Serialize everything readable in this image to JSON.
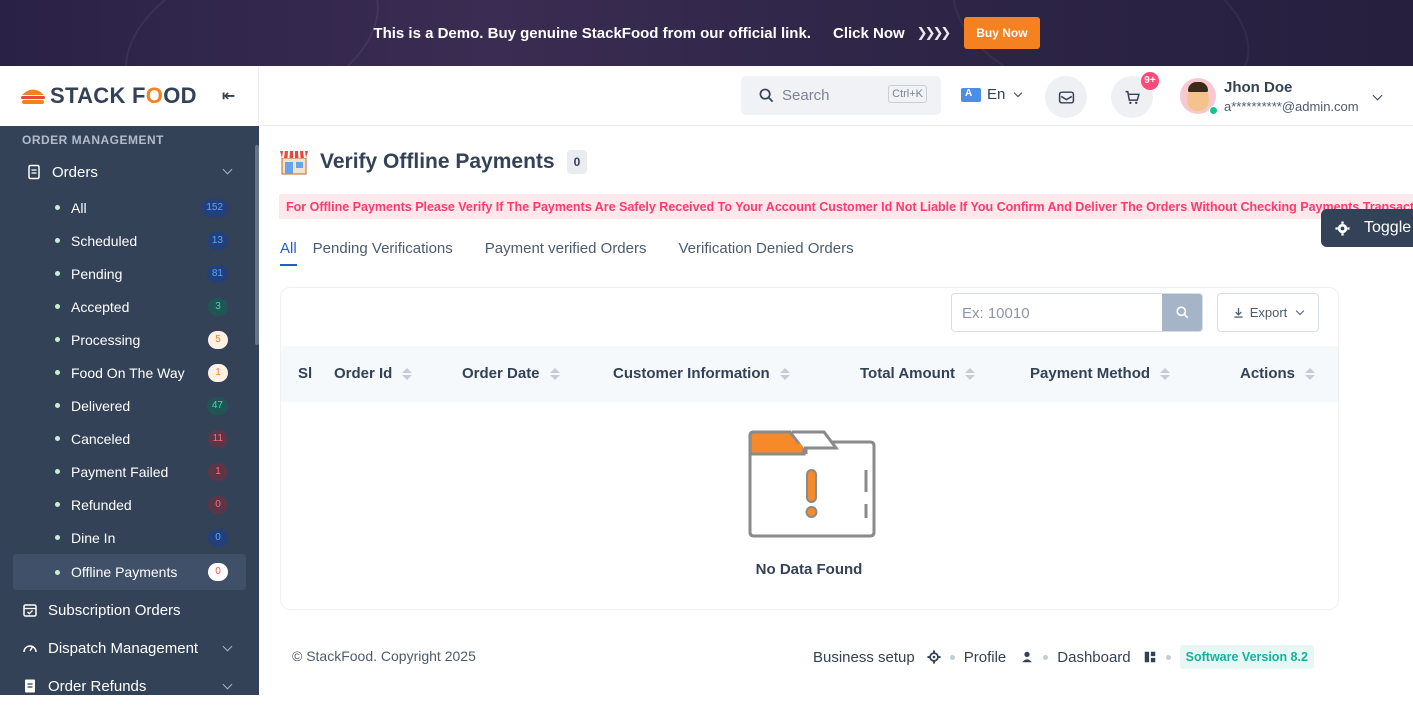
{
  "banner": {
    "text": "This is a Demo. Buy genuine StackFood from our official link.",
    "click_text": "Click Now",
    "buy_button": "Buy Now"
  },
  "brand": {
    "name_part1": "STACK F",
    "name_o": "O",
    "name_part2": "OD"
  },
  "sidebar": {
    "section_title": "ORDER MANAGEMENT",
    "orders_label": "Orders",
    "items": [
      {
        "label": "All",
        "count": "152",
        "color": "blue"
      },
      {
        "label": "Scheduled",
        "count": "13",
        "color": "blue"
      },
      {
        "label": "Pending",
        "count": "81",
        "color": "blue"
      },
      {
        "label": "Accepted",
        "count": "3",
        "color": "teal"
      },
      {
        "label": "Processing",
        "count": "5",
        "color": "orange"
      },
      {
        "label": "Food On The Way",
        "count": "1",
        "color": "orange"
      },
      {
        "label": "Delivered",
        "count": "47",
        "color": "teal"
      },
      {
        "label": "Canceled",
        "count": "11",
        "color": "red"
      },
      {
        "label": "Payment Failed",
        "count": "1",
        "color": "red"
      },
      {
        "label": "Refunded",
        "count": "0",
        "color": "red"
      },
      {
        "label": "Dine In",
        "count": "0",
        "color": "blue"
      },
      {
        "label": "Offline Payments",
        "count": "0",
        "color": "white"
      }
    ],
    "subscription_orders": "Subscription Orders",
    "dispatch_management": "Dispatch Management",
    "order_refunds": "Order Refunds"
  },
  "header": {
    "search_placeholder": "Search",
    "search_shortcut": "Ctrl+K",
    "language": "En",
    "cart_badge": "9+",
    "user_name": "Jhon Doe",
    "user_email": "a**********@admin.com"
  },
  "page": {
    "title": "Verify Offline Payments",
    "count": "0",
    "alert": "For Offline Payments Please Verify If The Payments Are Safely Received To Your Account Customer Id Not Liable If You Confirm And Deliver The Orders Without Checking Payments Transactions",
    "toggle": "Toggle",
    "tabs": [
      "All",
      "Pending Verifications",
      "Payment verified Orders",
      "Verification Denied Orders"
    ]
  },
  "table": {
    "search_placeholder": "Ex: 10010",
    "export_label": "Export",
    "columns": [
      "Sl",
      "Order Id",
      "Order Date",
      "Customer Information",
      "Total Amount",
      "Payment Method",
      "Actions"
    ],
    "empty_text": "No Data Found"
  },
  "footer": {
    "copyright": "© StackFood. Copyright 2025",
    "business_setup": "Business setup",
    "profile": "Profile",
    "dashboard": "Dashboard",
    "version": "Software Version 8.2"
  },
  "colors": {
    "sidebar_bg": "#334257",
    "accent": "#f58220",
    "primary_blue": "#245bd1",
    "alert_red": "#ff3a6e"
  }
}
